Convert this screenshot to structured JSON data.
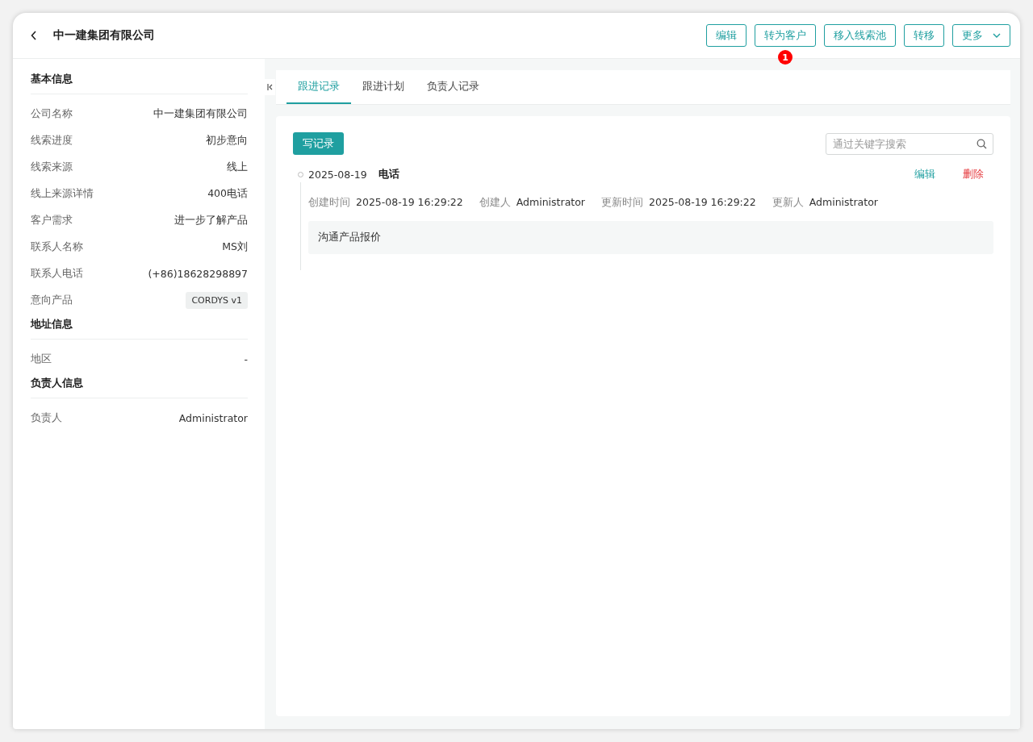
{
  "title": "中一建集团有限公司",
  "header_buttons": [
    {
      "label": "编辑",
      "kind": "button"
    },
    {
      "label": "转为客户",
      "kind": "button",
      "badge": "1"
    },
    {
      "label": "移入线索池",
      "kind": "button"
    },
    {
      "label": "转移",
      "kind": "button"
    },
    {
      "label": "更多",
      "kind": "dropdown"
    }
  ],
  "sections": [
    {
      "title": "基本信息",
      "fields": [
        {
          "label": "公司名称",
          "value": "中一建集团有限公司",
          "kind": "text"
        },
        {
          "label": "线索进度",
          "value": "初步意向",
          "kind": "text"
        },
        {
          "label": "线索来源",
          "value": "线上",
          "kind": "text"
        },
        {
          "label": "线上来源详情",
          "value": "400电话",
          "kind": "text"
        },
        {
          "label": "客户需求",
          "value": "进一步了解产品",
          "kind": "text"
        },
        {
          "label": "联系人名称",
          "value": "MS刘",
          "kind": "text"
        },
        {
          "label": "联系人电话",
          "value": "(+86)18628298897",
          "kind": "text"
        },
        {
          "label": "意向产品",
          "value": "CORDYS v1",
          "kind": "tag"
        }
      ]
    },
    {
      "title": "地址信息",
      "fields": [
        {
          "label": "地区",
          "value": "-",
          "kind": "text"
        }
      ]
    },
    {
      "title": "负责人信息",
      "fields": [
        {
          "label": "负责人",
          "value": "Administrator",
          "kind": "text"
        }
      ]
    }
  ],
  "tabs": [
    {
      "label": "跟进记录",
      "selected": true
    },
    {
      "label": "跟进计划",
      "selected": false
    },
    {
      "label": "负责人记录",
      "selected": false
    }
  ],
  "write_button": "写记录",
  "search": {
    "placeholder": "通过关键字搜索"
  },
  "records": [
    {
      "date": "2025-08-19",
      "type": "电话",
      "actions": [
        {
          "label": "编辑",
          "kind": "edit"
        },
        {
          "label": "删除",
          "kind": "delete"
        }
      ],
      "meta": [
        {
          "label": "创建时间",
          "value": "2025-08-19 16:29:22"
        },
        {
          "label": "创建人",
          "value": "Administrator"
        },
        {
          "label": "更新时间",
          "value": "2025-08-19 16:29:22"
        },
        {
          "label": "更新人",
          "value": "Administrator"
        }
      ],
      "content": "沟通产品报价"
    }
  ]
}
